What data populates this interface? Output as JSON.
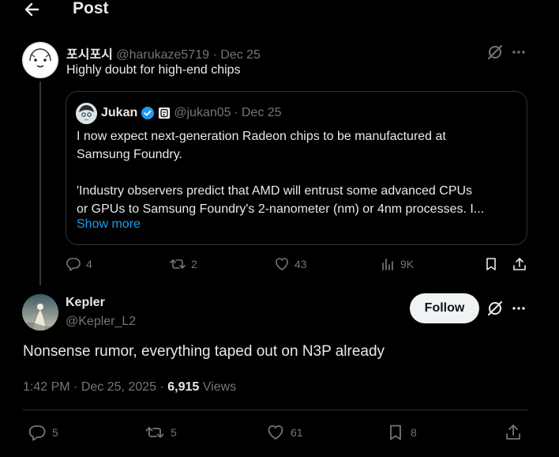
{
  "header": {
    "title": "Post"
  },
  "parent": {
    "display_name": "포시포시",
    "handle": "@harukaze5719",
    "sep": "·",
    "date": "Dec 25",
    "text": "Highly doubt for high-end chips",
    "quote": {
      "display_name": "Jukan",
      "handle": "@jukan05",
      "sep": "·",
      "date": "Dec 25",
      "line1": "I now expect next-generation Radeon chips to be manufactured at",
      "line2": "Samsung Foundry.",
      "line3": "'Industry observers predict that AMD will entrust some advanced CPUs",
      "line4": "or GPUs to Samsung Foundry's 2-nanometer (nm) or 4nm processes. I...",
      "show_more": "Show more"
    },
    "actions": {
      "replies": "4",
      "reposts": "2",
      "likes": "43",
      "views": "9K"
    }
  },
  "main": {
    "display_name": "Kepler",
    "handle": "@Kepler_L2",
    "follow_label": "Follow",
    "text": "Nonsense rumor, everything taped out on N3P already",
    "time": "1:42 PM",
    "sep": "·",
    "date": "Dec 25, 2025",
    "sep2": "·",
    "views_count": "6,915",
    "views_label": "Views",
    "actions": {
      "replies": "5",
      "reposts": "5",
      "likes": "61",
      "bookmarks": "8"
    }
  },
  "colors": {
    "accent": "#1d9bf0",
    "muted": "#71767b",
    "text": "#e7e9ea",
    "border": "#2f3336"
  },
  "icons": [
    "back-arrow-icon",
    "grok-icon",
    "more-icon",
    "verified-badge-icon",
    "affiliate-badge-icon",
    "reply-icon",
    "repost-icon",
    "like-icon",
    "views-icon",
    "bookmark-icon",
    "share-icon"
  ]
}
